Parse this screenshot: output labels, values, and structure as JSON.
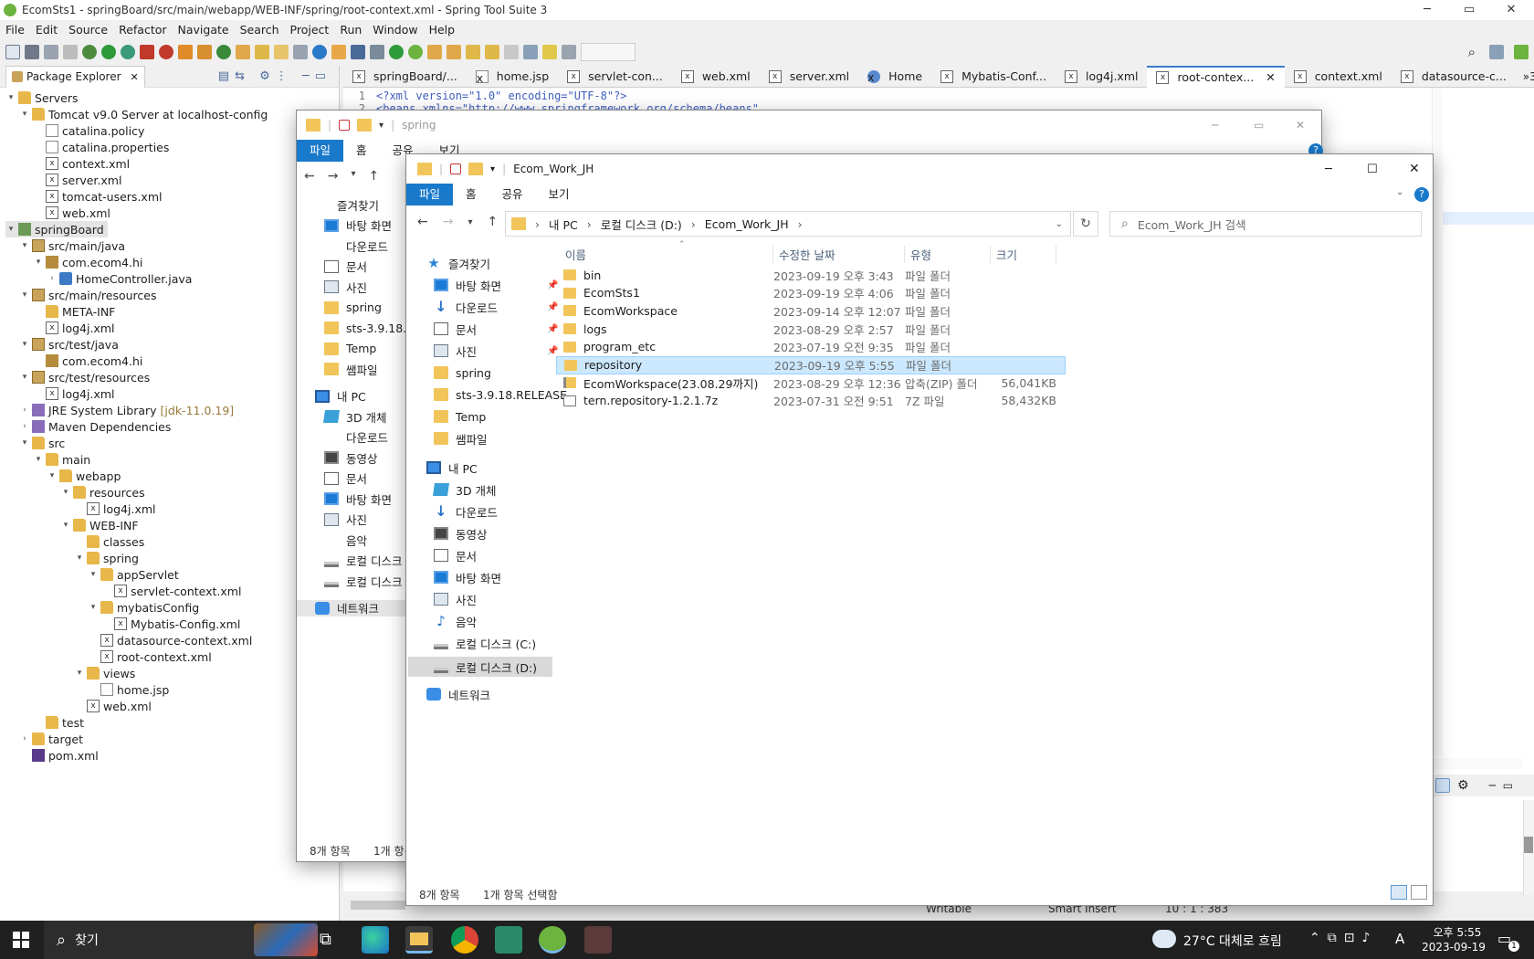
{
  "sts": {
    "title": "EcomSts1 - springBoard/src/main/webapp/WEB-INF/spring/root-context.xml - Spring Tool Suite 3",
    "window_controls": {
      "minimize": "─",
      "maximize": "▭",
      "close": "✕"
    },
    "menu": [
      "File",
      "Edit",
      "Source",
      "Refactor",
      "Navigate",
      "Search",
      "Project",
      "Run",
      "Window",
      "Help"
    ],
    "package_explorer": {
      "tab_label": "Package Explorer",
      "tree": [
        {
          "label": "Servers",
          "depth": 0,
          "twisty": "▾",
          "icon": "folder"
        },
        {
          "label": "Tomcat v9.0 Server at localhost-config",
          "depth": 1,
          "twisty": "▾",
          "icon": "folder"
        },
        {
          "label": "catalina.policy",
          "depth": 2,
          "twisty": "",
          "icon": "file"
        },
        {
          "label": "catalina.properties",
          "depth": 2,
          "twisty": "",
          "icon": "file"
        },
        {
          "label": "context.xml",
          "depth": 2,
          "twisty": "",
          "icon": "xml"
        },
        {
          "label": "server.xml",
          "depth": 2,
          "twisty": "",
          "icon": "xml"
        },
        {
          "label": "tomcat-users.xml",
          "depth": 2,
          "twisty": "",
          "icon": "xml"
        },
        {
          "label": "web.xml",
          "depth": 2,
          "twisty": "",
          "icon": "xml"
        },
        {
          "label": "springBoard",
          "depth": 0,
          "twisty": "▾",
          "icon": "proj",
          "selected": true
        },
        {
          "label": "src/main/java",
          "depth": 1,
          "twisty": "▾",
          "icon": "pkgf"
        },
        {
          "label": "com.ecom4.hi",
          "depth": 2,
          "twisty": "▾",
          "icon": "pkg"
        },
        {
          "label": "HomeController.java",
          "depth": 3,
          "twisty": "›",
          "icon": "java"
        },
        {
          "label": "src/main/resources",
          "depth": 1,
          "twisty": "▾",
          "icon": "pkgf"
        },
        {
          "label": "META-INF",
          "depth": 2,
          "twisty": "",
          "icon": "folder"
        },
        {
          "label": "log4j.xml",
          "depth": 2,
          "twisty": "",
          "icon": "xml"
        },
        {
          "label": "src/test/java",
          "depth": 1,
          "twisty": "▾",
          "icon": "pkgf"
        },
        {
          "label": "com.ecom4.hi",
          "depth": 2,
          "twisty": "",
          "icon": "pkg"
        },
        {
          "label": "src/test/resources",
          "depth": 1,
          "twisty": "▾",
          "icon": "pkgf"
        },
        {
          "label": "log4j.xml",
          "depth": 2,
          "twisty": "",
          "icon": "xml"
        },
        {
          "label": "JRE System Library",
          "suffix": "[jdk-11.0.19]",
          "depth": 1,
          "twisty": "›",
          "icon": "lib"
        },
        {
          "label": "Maven Dependencies",
          "depth": 1,
          "twisty": "›",
          "icon": "lib"
        },
        {
          "label": "src",
          "depth": 1,
          "twisty": "▾",
          "icon": "folder"
        },
        {
          "label": "main",
          "depth": 2,
          "twisty": "▾",
          "icon": "folder"
        },
        {
          "label": "webapp",
          "depth": 3,
          "twisty": "▾",
          "icon": "folder"
        },
        {
          "label": "resources",
          "depth": 4,
          "twisty": "▾",
          "icon": "folder"
        },
        {
          "label": "log4j.xml",
          "depth": 5,
          "twisty": "",
          "icon": "xml"
        },
        {
          "label": "WEB-INF",
          "depth": 4,
          "twisty": "▾",
          "icon": "folder"
        },
        {
          "label": "classes",
          "depth": 5,
          "twisty": "",
          "icon": "folder"
        },
        {
          "label": "spring",
          "depth": 5,
          "twisty": "▾",
          "icon": "folder"
        },
        {
          "label": "appServlet",
          "depth": 6,
          "twisty": "▾",
          "icon": "folder"
        },
        {
          "label": "servlet-context.xml",
          "depth": 7,
          "twisty": "",
          "icon": "xml"
        },
        {
          "label": "mybatisConfig",
          "depth": 6,
          "twisty": "▾",
          "icon": "folder"
        },
        {
          "label": "Mybatis-Config.xml",
          "depth": 7,
          "twisty": "",
          "icon": "xml"
        },
        {
          "label": "datasource-context.xml",
          "depth": 6,
          "twisty": "",
          "icon": "xml"
        },
        {
          "label": "root-context.xml",
          "depth": 6,
          "twisty": "",
          "icon": "xml"
        },
        {
          "label": "views",
          "depth": 5,
          "twisty": "▾",
          "icon": "folder"
        },
        {
          "label": "home.jsp",
          "depth": 6,
          "twisty": "",
          "icon": "file"
        },
        {
          "label": "web.xml",
          "depth": 5,
          "twisty": "",
          "icon": "xml"
        },
        {
          "label": "test",
          "depth": 2,
          "twisty": "",
          "icon": "folder"
        },
        {
          "label": "target",
          "depth": 1,
          "twisty": "›",
          "icon": "folder"
        },
        {
          "label": "pom.xml",
          "depth": 1,
          "twisty": "",
          "icon": "pom"
        }
      ]
    },
    "editor_tabs": [
      "springBoard/...",
      "home.jsp",
      "servlet-con...",
      "web.xml",
      "server.xml",
      "Home",
      "Mybatis-Conf...",
      "log4j.xml",
      "root-contex...",
      "context.xml",
      "datasource-c..."
    ],
    "editor_tabs_overflow": "»3",
    "code": [
      {
        "num": "1",
        "text": "<?xml version=\"1.0\" encoding=\"UTF-8\"?>"
      },
      {
        "num": "2",
        "text": "<beans xmlns=\"http://www.springframework.org/schema/beans\""
      }
    ],
    "status": {
      "writable": "Writable",
      "insert": "Smart Insert",
      "position": "10 : 1 : 383"
    }
  },
  "explorer_back": {
    "path_label": "spring",
    "ribbon": [
      "파일",
      "홈",
      "공유",
      "보기"
    ],
    "nav": [
      "즐겨찾기",
      "바탕 화면",
      "다운로드",
      "문서",
      "사진",
      "spring",
      "sts-3.9.18.RE",
      "Temp",
      "쌤파일",
      "내 PC",
      "3D 개체",
      "다운로드",
      "동영상",
      "문서",
      "바탕 화면",
      "사진",
      "음악",
      "로컬 디스크",
      "로컬 디스크",
      "네트워크"
    ],
    "status_count": "8개 항목",
    "status_selected": "1개 항목"
  },
  "explorer_front": {
    "title": "Ecom_Work_JH",
    "ribbon": [
      "파일",
      "홈",
      "공유",
      "보기"
    ],
    "breadcrumb": [
      "내 PC",
      "로컬 디스크 (D:)",
      "Ecom_Work_JH"
    ],
    "search_placeholder": "Ecom_Work_JH 검색",
    "columns": {
      "name": "이름",
      "date": "수정한 날짜",
      "type": "유형",
      "size": "크기"
    },
    "nav": [
      {
        "label": "즐겨찾기",
        "icon": "star",
        "indent": 0
      },
      {
        "label": "바탕 화면",
        "icon": "desk",
        "indent": 1,
        "pin": true
      },
      {
        "label": "다운로드",
        "icon": "down",
        "indent": 1,
        "pin": true
      },
      {
        "label": "문서",
        "icon": "doc",
        "indent": 1,
        "pin": true
      },
      {
        "label": "사진",
        "icon": "pic",
        "indent": 1,
        "pin": true
      },
      {
        "label": "spring",
        "icon": "fold",
        "indent": 1
      },
      {
        "label": "sts-3.9.18.RELEASE",
        "icon": "fold",
        "indent": 1
      },
      {
        "label": "Temp",
        "icon": "fold",
        "indent": 1
      },
      {
        "label": "쌤파일",
        "icon": "fold",
        "indent": 1
      },
      {
        "label": "내 PC",
        "icon": "pc",
        "indent": 0
      },
      {
        "label": "3D 개체",
        "icon": "cube",
        "indent": 1
      },
      {
        "label": "다운로드",
        "icon": "down",
        "indent": 1
      },
      {
        "label": "동영상",
        "icon": "vid",
        "indent": 1
      },
      {
        "label": "문서",
        "icon": "doc",
        "indent": 1
      },
      {
        "label": "바탕 화면",
        "icon": "desk",
        "indent": 1
      },
      {
        "label": "사진",
        "icon": "pic",
        "indent": 1
      },
      {
        "label": "음악",
        "icon": "music",
        "indent": 1
      },
      {
        "label": "로컬 디스크 (C:)",
        "icon": "disk",
        "indent": 1
      },
      {
        "label": "로컬 디스크 (D:)",
        "icon": "disk",
        "indent": 1,
        "selected": true
      },
      {
        "label": "네트워크",
        "icon": "net",
        "indent": 0
      }
    ],
    "files": [
      {
        "name": "bin",
        "date": "2023-09-19 오후 3:43",
        "type": "파일 폴더",
        "size": "",
        "icon": "folder"
      },
      {
        "name": "EcomSts1",
        "date": "2023-09-19 오후 4:06",
        "type": "파일 폴더",
        "size": "",
        "icon": "folder"
      },
      {
        "name": "EcomWorkspace",
        "date": "2023-09-14 오후 12:07",
        "type": "파일 폴더",
        "size": "",
        "icon": "folder"
      },
      {
        "name": "logs",
        "date": "2023-08-29 오후 2:57",
        "type": "파일 폴더",
        "size": "",
        "icon": "folder"
      },
      {
        "name": "program_etc",
        "date": "2023-07-19 오전 9:35",
        "type": "파일 폴더",
        "size": "",
        "icon": "folder"
      },
      {
        "name": "repository",
        "date": "2023-09-19 오후 5:55",
        "type": "파일 폴더",
        "size": "",
        "icon": "folder",
        "selected": true
      },
      {
        "name": "EcomWorkspace(23.08.29까지)",
        "date": "2023-08-29 오후 12:36",
        "type": "압축(ZIP) 폴더",
        "size": "56,041KB",
        "icon": "zip"
      },
      {
        "name": "tern.repository-1.2.1.7z",
        "date": "2023-07-31 오전 9:51",
        "type": "7Z 파일",
        "size": "58,432KB",
        "icon": "doc"
      }
    ],
    "status_count": "8개 항목",
    "status_selected": "1개 항목 선택함"
  },
  "taskbar": {
    "search_label": "찾기",
    "weather": "27°C  대체로 흐림",
    "time": "오후 5:55",
    "date": "2023-09-19",
    "notif_count": "1",
    "ime": "A"
  },
  "colors": {
    "accent": "#1979ca",
    "selection": "#cce8ff",
    "taskbar": "#202020"
  }
}
